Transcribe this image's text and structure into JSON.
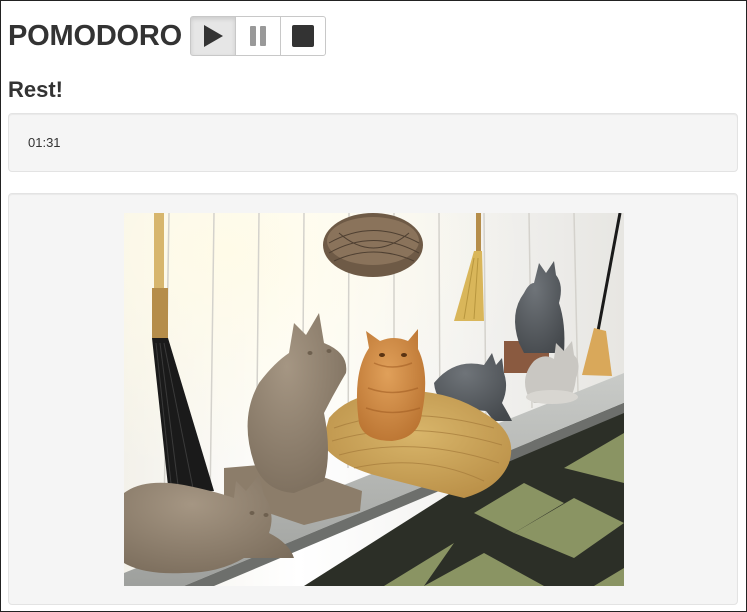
{
  "app": {
    "title": "POMODORO"
  },
  "controls": {
    "play_icon": "play-icon",
    "pause_icon": "pause-icon",
    "stop_icon": "stop-icon",
    "active": "play"
  },
  "status": {
    "heading": "Rest!"
  },
  "timer": {
    "display": "01:31"
  },
  "image": {
    "alt": "Orange cat sitting on a woven mat among stone cat statues"
  },
  "colors": {
    "text": "#333333",
    "panel_bg": "#f5f5f5",
    "panel_border": "#e3e3e3",
    "button_border": "#c8c8c8",
    "icon_dark": "#333333",
    "icon_light": "#999999"
  }
}
